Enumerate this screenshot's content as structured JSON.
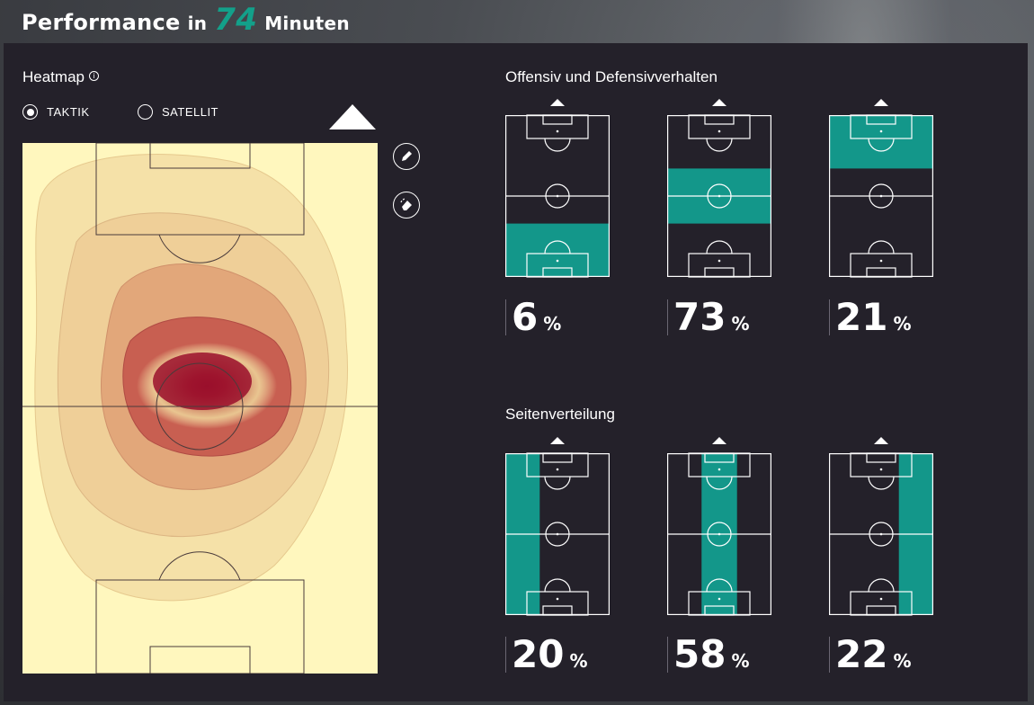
{
  "header": {
    "title_prefix": "Performance",
    "title_in": "in",
    "minutes": "74",
    "title_suffix": "Minuten"
  },
  "heatmap": {
    "title": "Heatmap",
    "info_icon": "i",
    "modes": [
      {
        "label": "TAKTIK",
        "selected": true
      },
      {
        "label": "SATELLIT",
        "selected": false
      }
    ],
    "tools": [
      "pencil-icon",
      "eraser-icon"
    ],
    "colors": {
      "pitch": "#fff7be",
      "light": "#f5dca2",
      "mid": "#d9926a",
      "deep": "#9a0f2c"
    }
  },
  "offensive": {
    "title": "Offensiv und Defensivverhalten",
    "items": [
      {
        "value": "6",
        "unit": "%",
        "zone": "bottom"
      },
      {
        "value": "73",
        "unit": "%",
        "zone": "middle"
      },
      {
        "value": "21",
        "unit": "%",
        "zone": "top"
      }
    ]
  },
  "sides": {
    "title": "Seitenverteilung",
    "items": [
      {
        "value": "20",
        "unit": "%",
        "zone": "left"
      },
      {
        "value": "58",
        "unit": "%",
        "zone": "center"
      },
      {
        "value": "22",
        "unit": "%",
        "zone": "right"
      }
    ]
  },
  "accent": "#13978a"
}
